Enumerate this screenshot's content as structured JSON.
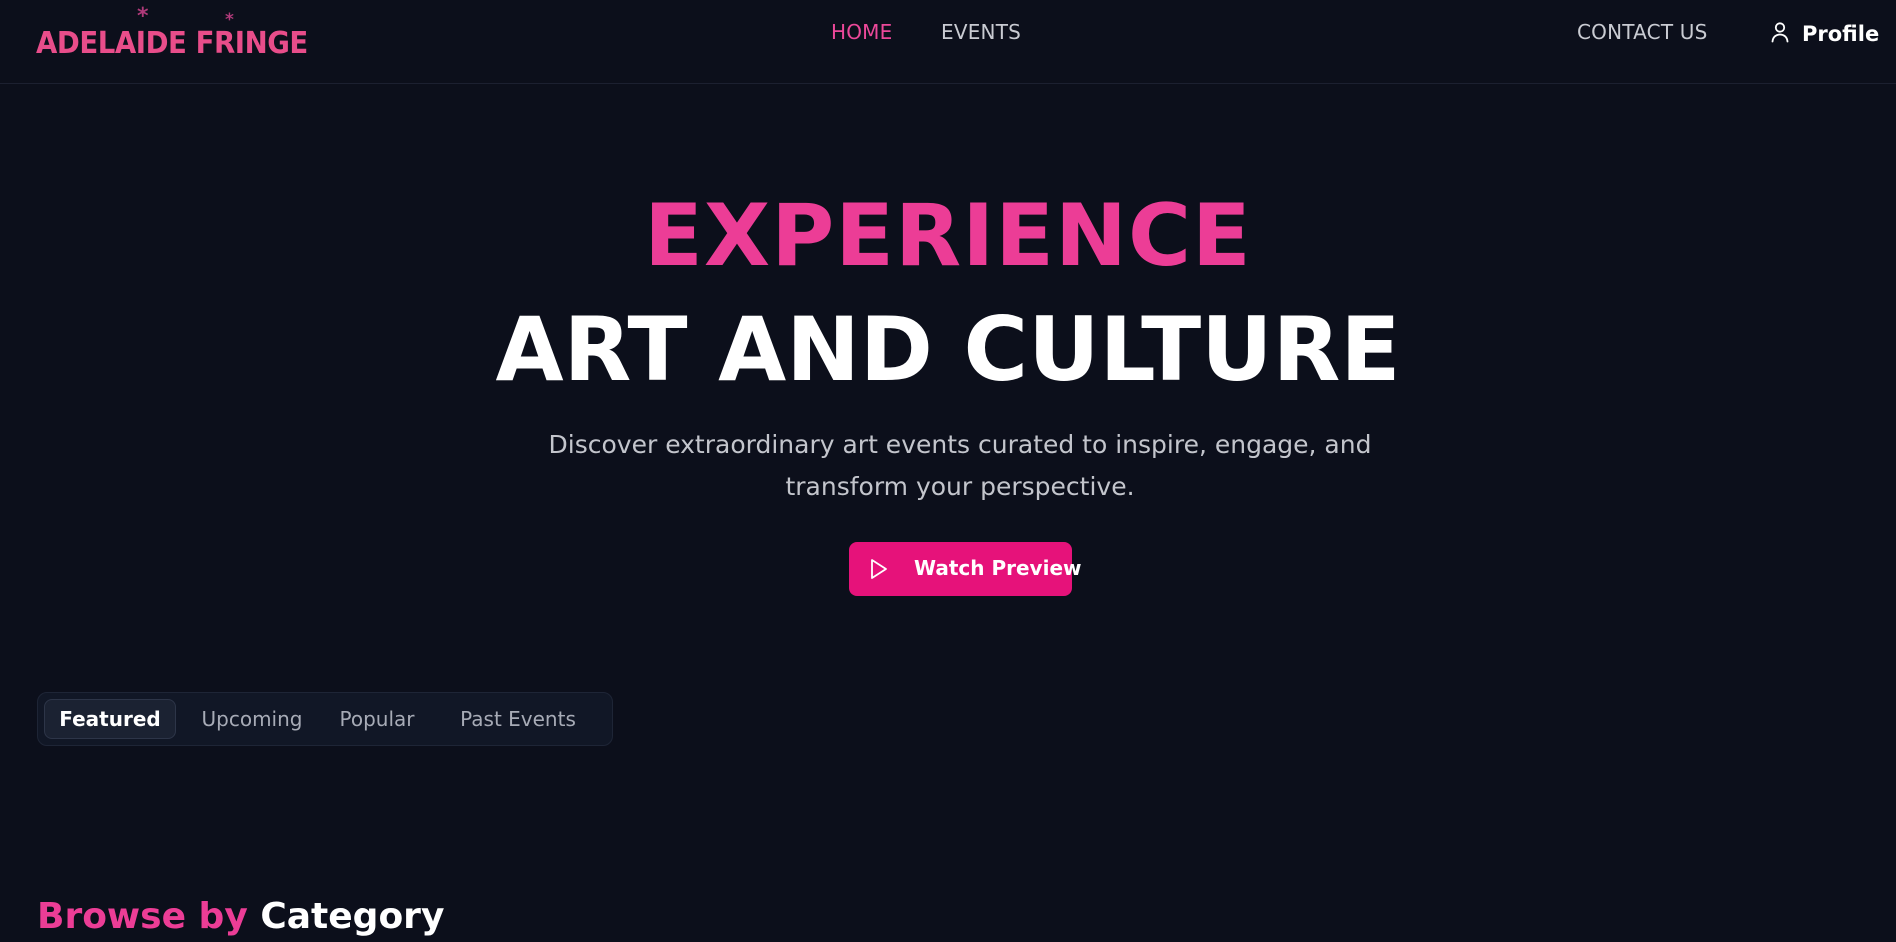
{
  "header": {
    "logo_text": "ADELAIDE FRINGE",
    "nav": {
      "home": "HOME",
      "events": "EVENTS",
      "contact": "CONTACT US"
    },
    "profile_label": "Profile",
    "profile_icon": "user-icon"
  },
  "hero": {
    "title_line1": "EXPERIENCE",
    "title_line2": "ART AND CULTURE",
    "subtitle": "Discover extraordinary art events curated to inspire, engage, and transform your perspective.",
    "cta_label": "Watch Preview",
    "cta_icon": "play-icon"
  },
  "tabs": {
    "items": [
      {
        "label": "Featured",
        "active": true
      },
      {
        "label": "Upcoming",
        "active": false
      },
      {
        "label": "Popular",
        "active": false
      },
      {
        "label": "Past Events",
        "active": false
      }
    ]
  },
  "browse": {
    "heading_accent": "Browse by",
    "heading_rest": "Category"
  },
  "colors": {
    "background": "#0c0f1b",
    "accent": "#ec4899",
    "cta": "#e6127a",
    "text_muted": "#c9cbd2"
  }
}
